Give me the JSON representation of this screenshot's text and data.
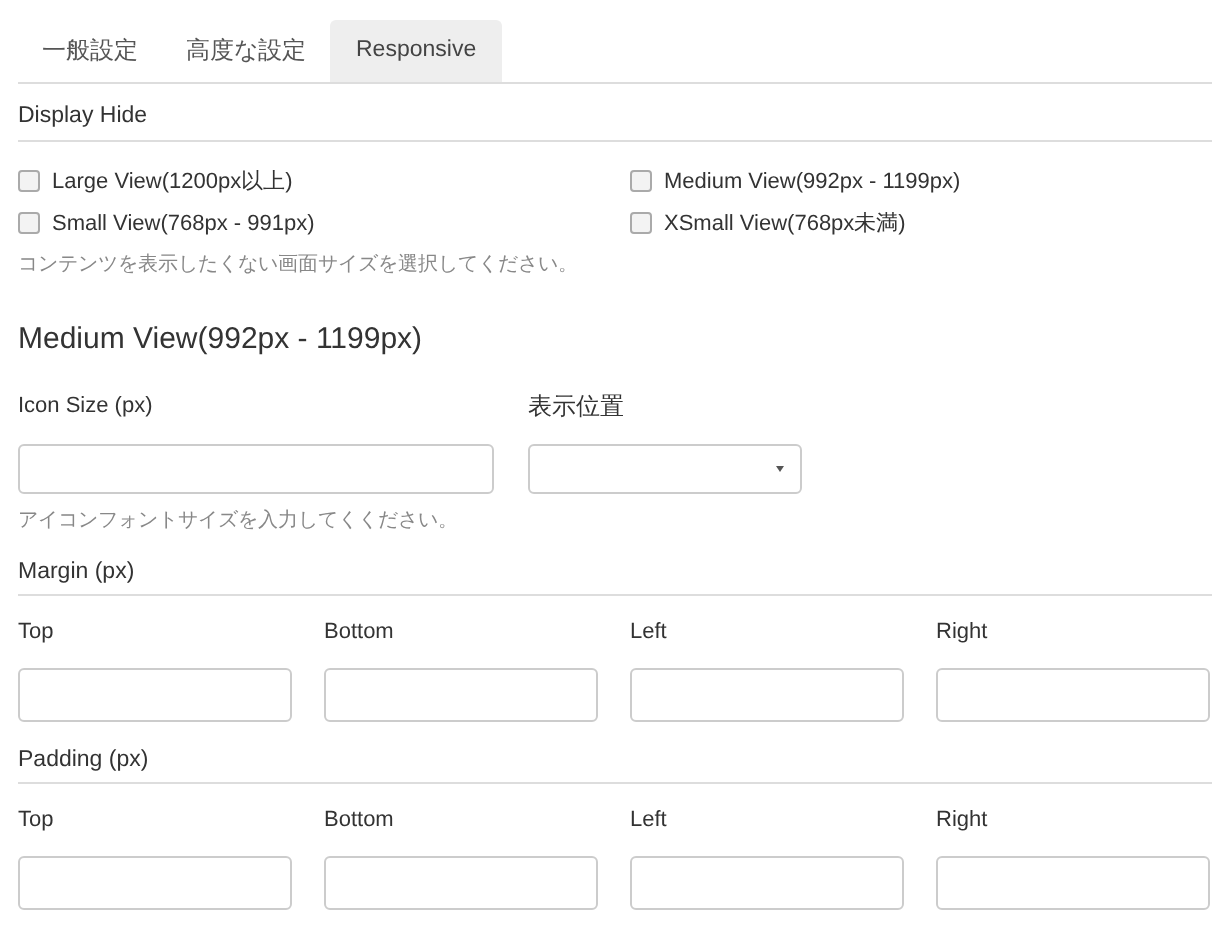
{
  "tabs": [
    {
      "label": "一般設定",
      "selected": false
    },
    {
      "label": "高度な設定",
      "selected": false
    },
    {
      "label": "Responsive",
      "selected": true
    }
  ],
  "display_hide": {
    "title": "Display Hide",
    "options": [
      {
        "label": "Large View(1200px以上)",
        "checked": false
      },
      {
        "label": "Medium View(992px - 1199px)",
        "checked": false
      },
      {
        "label": "Small View(768px - 991px)",
        "checked": false
      },
      {
        "label": "XSmall View(768px未満)",
        "checked": false
      }
    ],
    "help": "コンテンツを表示したくない画面サイズを選択してください。"
  },
  "view_heading": "Medium View(992px - 1199px)",
  "icon_size": {
    "label": "Icon Size (px)",
    "help": "アイコンフォントサイズを入力してくください。"
  },
  "position": {
    "label": "表示位置"
  },
  "groups": [
    {
      "title": "Margin (px)",
      "fields": [
        "Top",
        "Bottom",
        "Left",
        "Right"
      ]
    },
    {
      "title": "Padding (px)",
      "fields": [
        "Top",
        "Bottom",
        "Left",
        "Right"
      ]
    }
  ]
}
